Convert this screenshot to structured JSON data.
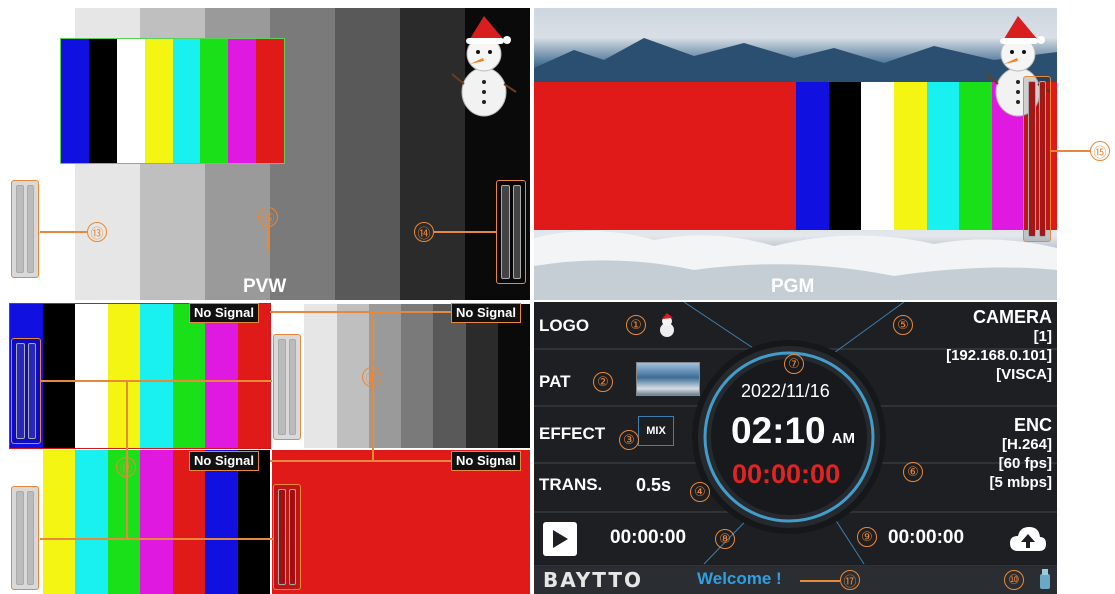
{
  "pvw": {
    "label": "PVW"
  },
  "pgm": {
    "label": "PGM"
  },
  "multiview": {
    "no_signal": "No Signal"
  },
  "status": {
    "logo_label": "LOGO",
    "pat_label": "PAT",
    "effect_label": "EFFECT",
    "effect_value": "MIX",
    "trans_label": "TRANS.",
    "trans_value": "0.5s",
    "date": "2022/11/16",
    "time": "02:10",
    "ampm": "AM",
    "timer": "00:00:00",
    "camera_label": "CAMERA",
    "camera_id": "[1]",
    "camera_ip": "[192.168.0.101]",
    "camera_protocol": "[VISCA]",
    "enc_label": "ENC",
    "enc_codec": "[H.264]",
    "enc_fps": "[60 fps]",
    "enc_bitrate": "[5 mbps]",
    "play_time": "00:00:00",
    "stream_time": "00:00:00",
    "brand": "BAYTTO",
    "welcome": "Welcome !"
  },
  "callouts": {
    "c1": "①",
    "c2": "②",
    "c3": "③",
    "c4": "④",
    "c5": "⑤",
    "c6": "⑥",
    "c7": "⑦",
    "c8": "⑧",
    "c9": "⑨",
    "c10": "⑩",
    "c11": "⑪",
    "c12": "⑫",
    "c13": "⑬",
    "c14": "⑭",
    "c15": "⑮",
    "c16": "⑯",
    "c17": "⑰"
  },
  "colors": {
    "accent": "#e8883a",
    "timer_red": "#e02424",
    "welcome_blue": "#2ea0e0",
    "panel_bg": "#1e1f22"
  },
  "icons": [
    "snowman-icon",
    "play-icon",
    "cloud-upload-icon",
    "usb-icon"
  ]
}
